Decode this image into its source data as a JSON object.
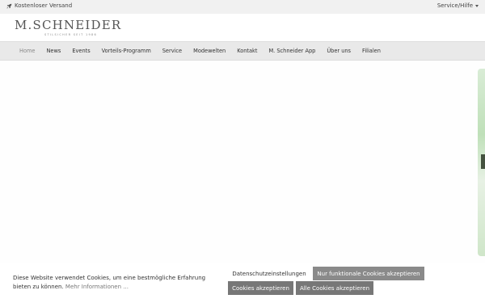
{
  "topbar": {
    "shipping_label": "Kostenloser Versand",
    "service_label": "Service/Hilfe"
  },
  "header": {
    "logo_text": "M.SCHNEIDER",
    "logo_tagline": "STILSICHER SEIT 1986"
  },
  "nav": {
    "items": [
      {
        "label": "Home",
        "active": true
      },
      {
        "label": "News"
      },
      {
        "label": "Events"
      },
      {
        "label": "Vorteils-Programm"
      },
      {
        "label": "Service"
      },
      {
        "label": "Modewelten"
      },
      {
        "label": "Kontakt"
      },
      {
        "label": "M. Schneider App"
      },
      {
        "label": "Über uns"
      },
      {
        "label": "Filialen"
      }
    ]
  },
  "cookie": {
    "text": "Diese Website verwendet Cookies, um eine bestmögliche Erfahrung bieten zu können.",
    "more_link": "Mehr Informationen ...",
    "privacy_settings": "Datenschutzeinstellungen",
    "functional_only": "Nur funktionale Cookies akzeptieren",
    "accept": "Cookies akzeptieren",
    "accept_all": "Alle Cookies akzeptieren"
  },
  "colors": {
    "topbar_bg": "#f1f1f1",
    "nav_bg": "#e9e9e9",
    "button_dark": "#777777",
    "logo": "#555555"
  }
}
